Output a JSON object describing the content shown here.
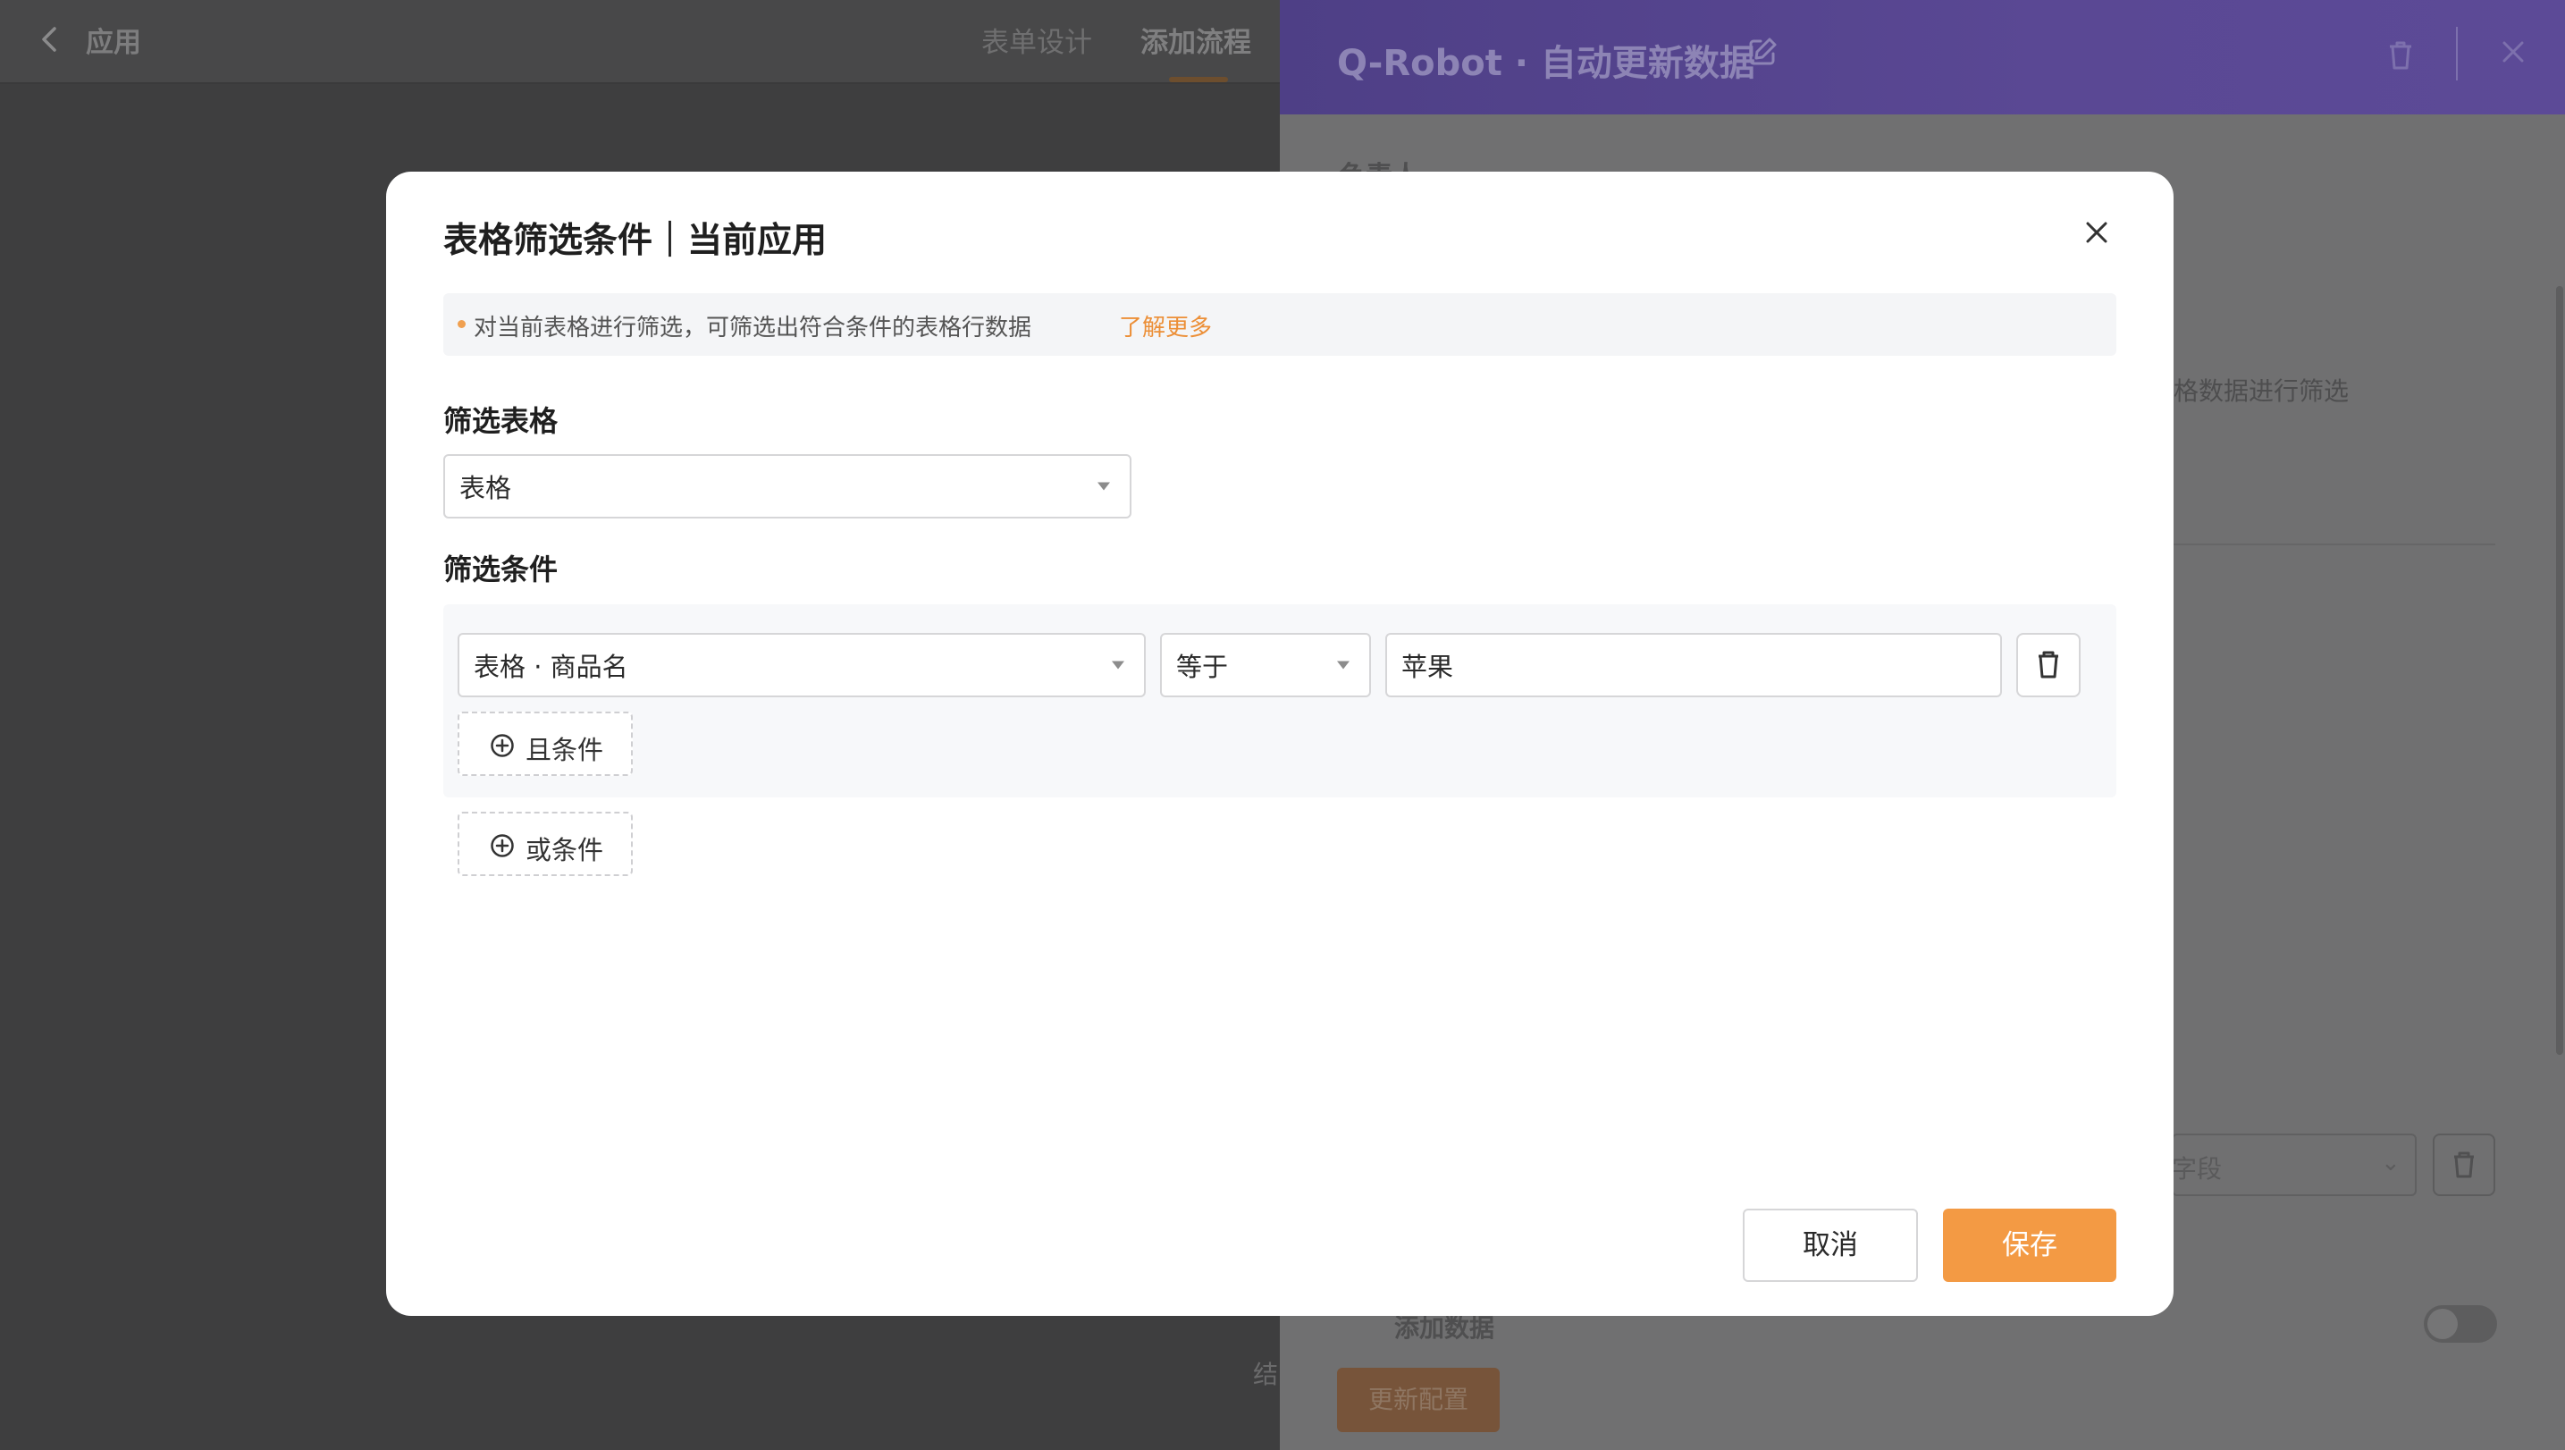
{
  "app": {
    "back_icon": "chevron-left-icon",
    "title": "应用",
    "tabs": [
      {
        "label": "表单设计",
        "active": false
      },
      {
        "label": "添加流程",
        "active": true
      }
    ],
    "node_label_partial": "结"
  },
  "drawer": {
    "title": "Q-Robot · 自动更新数据",
    "header_color": "#5a4894",
    "icons": [
      "edit-icon",
      "trash-icon",
      "close-icon"
    ],
    "label_responsible_partial": "负责人",
    "hint_partial": "格数据进行筛选",
    "field_select_partial": "字段",
    "add_data_label": "添加数据",
    "update_button": "更新配置"
  },
  "modal": {
    "title": "表格筛选条件｜当前应用",
    "info_text": "对当前表格进行筛选，可筛选出符合条件的表格行数据",
    "info_link": "了解更多",
    "filter_table_label": "筛选表格",
    "filter_table_value": "表格",
    "filter_conditions_label": "筛选条件",
    "condition": {
      "field": "表格 · 商品名",
      "operator": "等于",
      "value": "苹果"
    },
    "and_condition": "且条件",
    "or_condition": "或条件",
    "cancel": "取消",
    "save": "保存",
    "accent_color": "#f39a44"
  }
}
